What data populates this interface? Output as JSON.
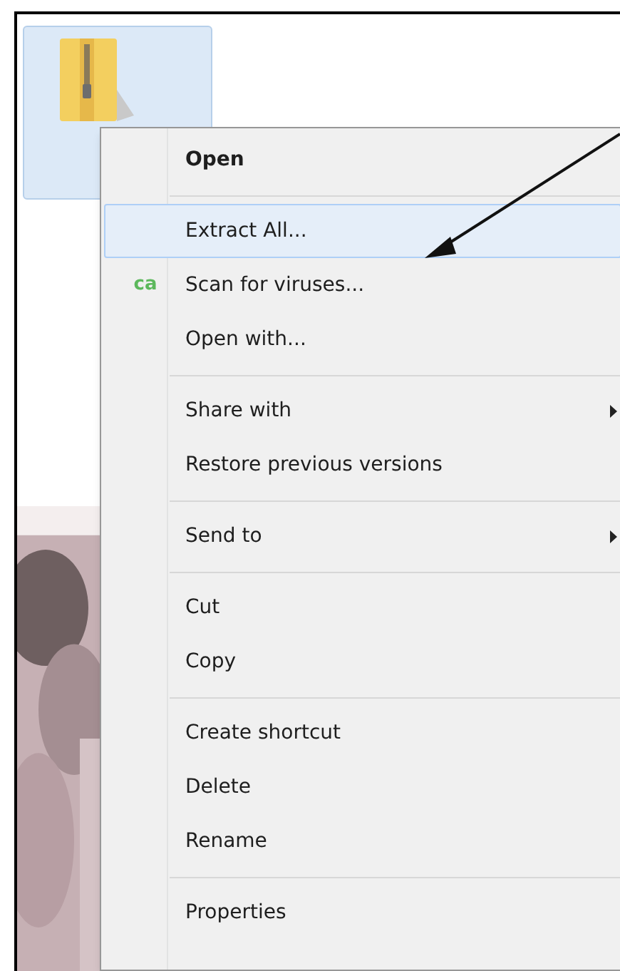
{
  "menu": {
    "items": [
      {
        "kind": "item",
        "label": "Open",
        "bold": true,
        "selected": false,
        "submenu": false
      },
      {
        "kind": "separator"
      },
      {
        "kind": "item",
        "label": "Extract All...",
        "bold": false,
        "selected": true,
        "submenu": false
      },
      {
        "kind": "item",
        "label": "Scan for viruses...",
        "bold": false,
        "selected": false,
        "submenu": false,
        "icon_text": "ca",
        "color": "#5cb85c"
      },
      {
        "kind": "item",
        "label": "Open with...",
        "bold": false,
        "selected": false,
        "submenu": false
      },
      {
        "kind": "separator"
      },
      {
        "kind": "item",
        "label": "Share with",
        "bold": false,
        "selected": false,
        "submenu": true
      },
      {
        "kind": "item",
        "label": "Restore previous versions",
        "bold": false,
        "selected": false,
        "submenu": false
      },
      {
        "kind": "separator"
      },
      {
        "kind": "item",
        "label": "Send to",
        "bold": false,
        "selected": false,
        "submenu": true
      },
      {
        "kind": "separator"
      },
      {
        "kind": "item",
        "label": "Cut",
        "bold": false,
        "selected": false,
        "submenu": false
      },
      {
        "kind": "item",
        "label": "Copy",
        "bold": false,
        "selected": false,
        "submenu": false
      },
      {
        "kind": "separator"
      },
      {
        "kind": "item",
        "label": "Create shortcut",
        "bold": false,
        "selected": false,
        "submenu": false
      },
      {
        "kind": "item",
        "label": "Delete",
        "bold": false,
        "selected": false,
        "submenu": false
      },
      {
        "kind": "item",
        "label": "Rename",
        "bold": false,
        "selected": false,
        "submenu": false
      },
      {
        "kind": "separator"
      },
      {
        "kind": "item",
        "label": "Properties",
        "bold": false,
        "selected": false,
        "submenu": false
      }
    ]
  }
}
